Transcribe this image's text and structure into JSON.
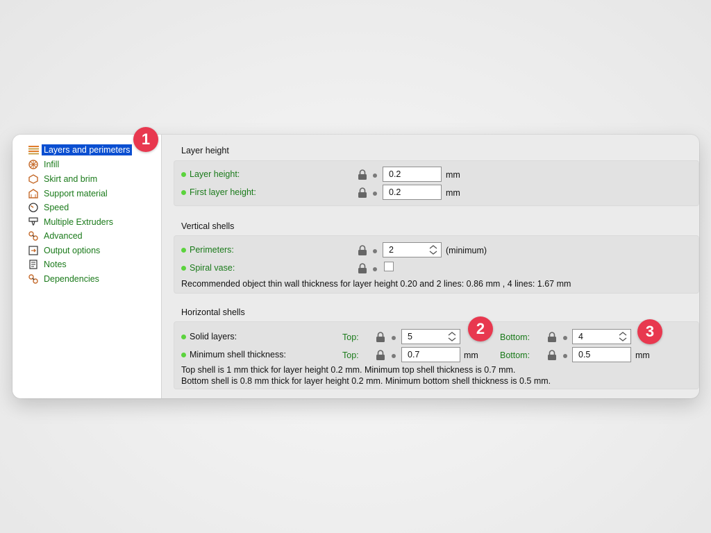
{
  "sidebar": {
    "items": [
      {
        "label": "Layers and perimeters",
        "icon": "layers-icon",
        "active": true
      },
      {
        "label": "Infill",
        "icon": "infill-icon"
      },
      {
        "label": "Skirt and brim",
        "icon": "skirt-brim-icon"
      },
      {
        "label": "Support material",
        "icon": "support-material-icon"
      },
      {
        "label": "Speed",
        "icon": "speed-gauge-icon"
      },
      {
        "label": "Multiple Extruders",
        "icon": "extruder-icon"
      },
      {
        "label": "Advanced",
        "icon": "advanced-wrench-icon"
      },
      {
        "label": "Output options",
        "icon": "output-options-icon"
      },
      {
        "label": "Notes",
        "icon": "notes-icon"
      },
      {
        "label": "Dependencies",
        "icon": "dependencies-icon"
      }
    ]
  },
  "layer_height": {
    "title": "Layer height",
    "layer_height_label": "Layer height:",
    "layer_height_value": "0.2",
    "first_layer_height_label": "First layer height:",
    "first_layer_height_value": "0.2",
    "unit": "mm"
  },
  "vertical_shells": {
    "title": "Vertical shells",
    "perimeters_label": "Perimeters:",
    "perimeters_value": "2",
    "perimeters_suffix": "(minimum)",
    "spiral_vase_label": "Spiral vase:",
    "note": "Recommended object thin wall thickness for layer height 0.20 and 2 lines: 0.86 mm , 4 lines: 1.67 mm"
  },
  "horizontal_shells": {
    "title": "Horizontal shells",
    "solid_layers_label": "Solid layers:",
    "top_label": "Top:",
    "bottom_label": "Bottom:",
    "solid_top_value": "5",
    "solid_bottom_value": "4",
    "min_shell_label": "Minimum shell thickness:",
    "min_top_value": "0.7",
    "min_bottom_value": "0.5",
    "unit": "mm",
    "note1": "Top shell is 1 mm thick for layer height 0.2 mm. Minimum top shell thickness is 0.7 mm.",
    "note2": "Bottom shell is 0.8 mm thick for layer height 0.2 mm. Minimum bottom shell thickness is 0.5 mm."
  },
  "badges": [
    "1",
    "2",
    "3"
  ],
  "colors": {
    "accent": "#0b4fd1",
    "label_green": "#1a7a1a",
    "status_dot": "#5bd33d",
    "badge": "#e8384f"
  }
}
